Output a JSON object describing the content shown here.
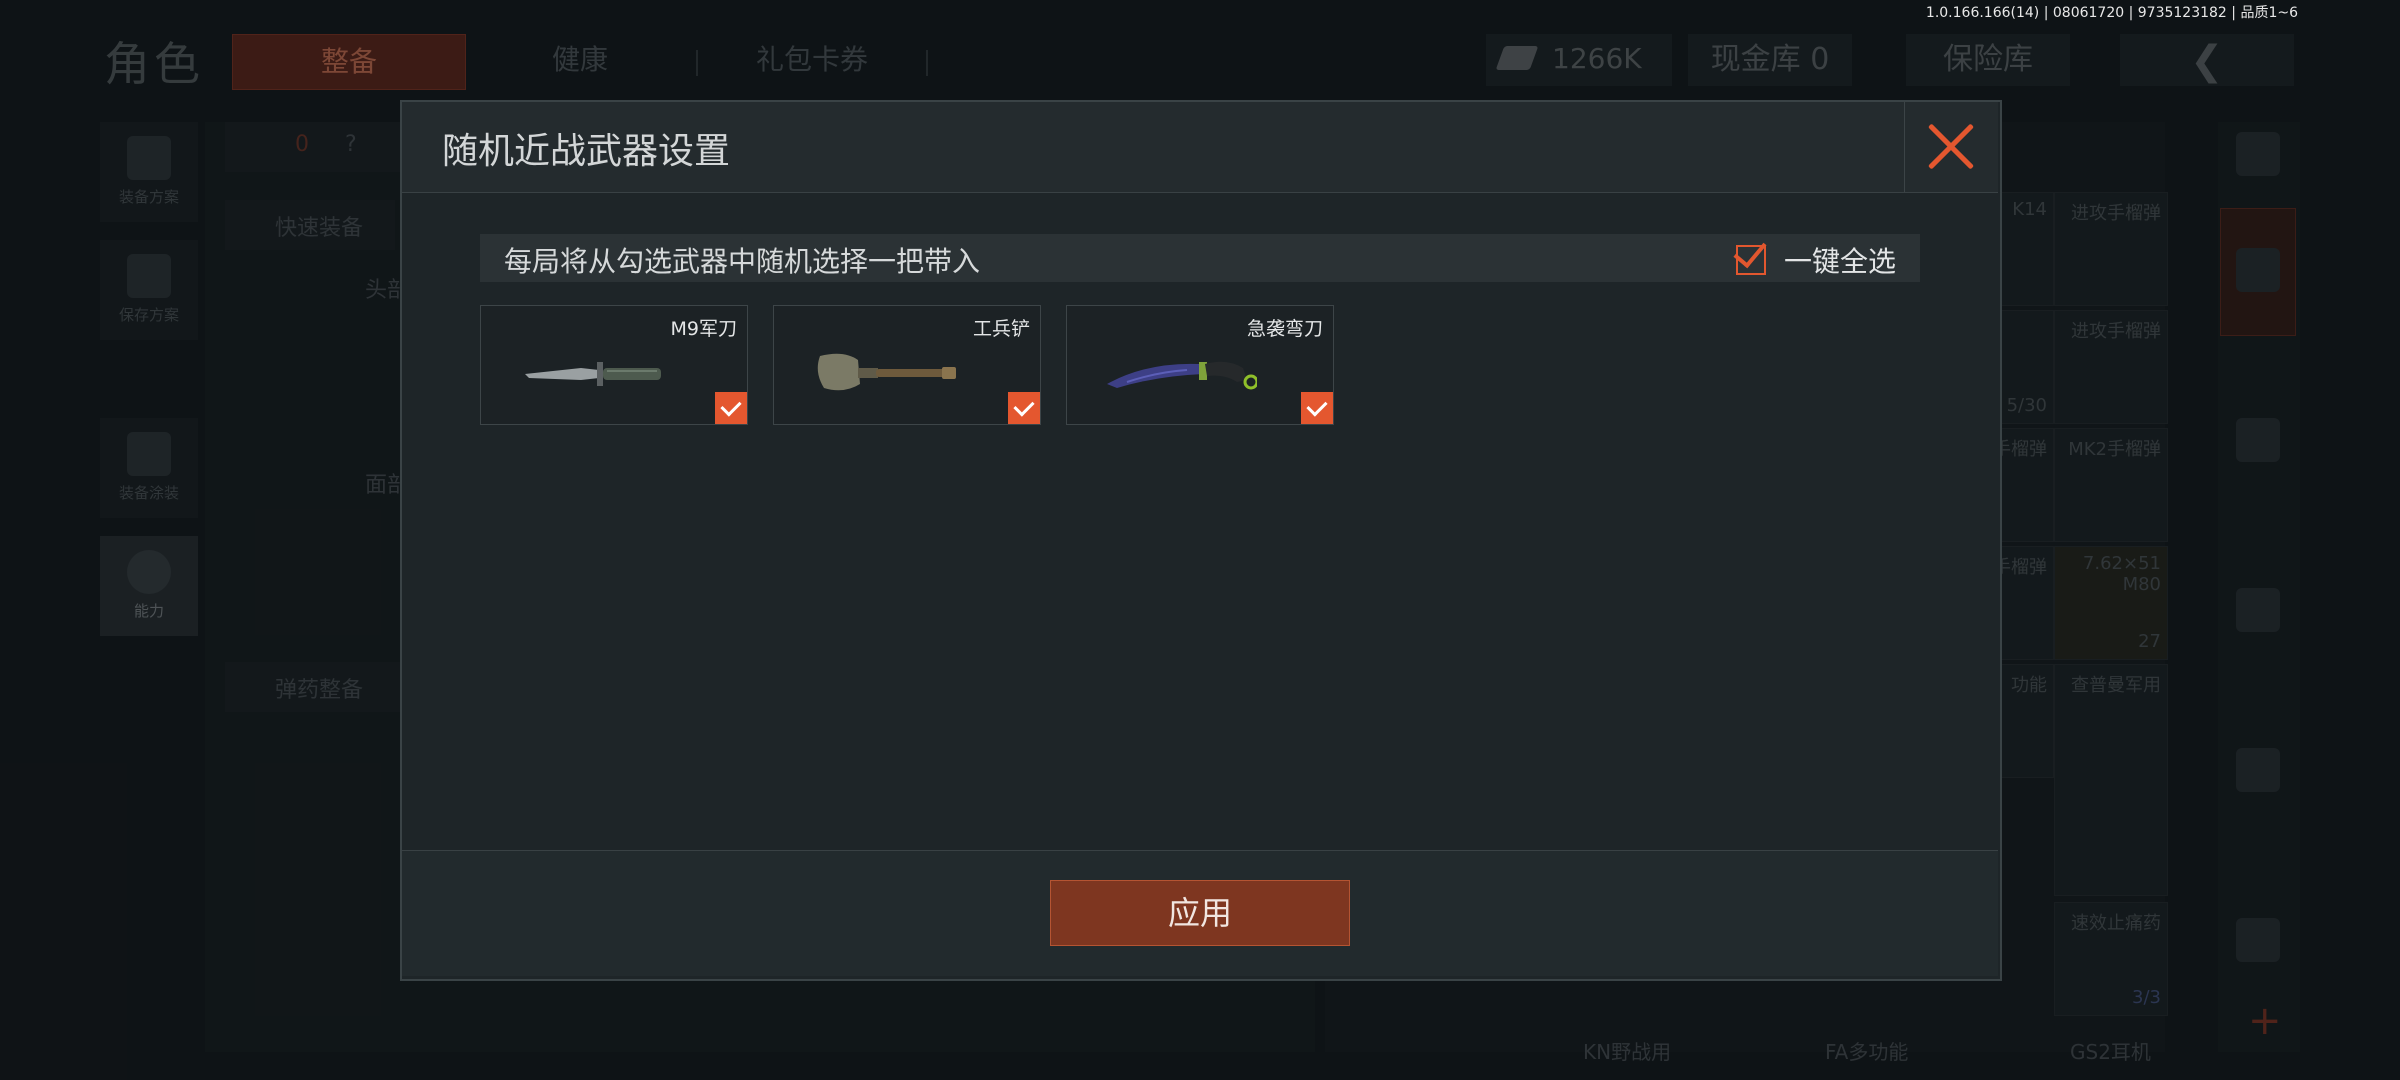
{
  "version": "1.0.166.166(14) | 08061720 | 9735123182 | 品质1~6",
  "topbar": {
    "title": "角色",
    "tabs": [
      "整备",
      "健康",
      "礼包卡券"
    ],
    "money": "1266K",
    "cash_vault": "现金库 0",
    "safe": "保险库"
  },
  "left_nav": {
    "items": [
      "装备方案",
      "保存方案",
      "装备涂装",
      "能力"
    ]
  },
  "bg_panel": {
    "counter": "0",
    "help": "?",
    "quick_equip": "快速装备",
    "head_label": "头部",
    "face_label": "面部",
    "ammo_equip": "弹药整备"
  },
  "bg_grid": {
    "items": [
      "K14",
      "进攻手榴弹",
      "进攻手榴弹",
      "5/30",
      "手榴弹",
      "MK2手榴弹",
      "手榴弹",
      "7.62×51 M80",
      "27",
      "功能",
      "查普曼军用",
      "速效止痛药",
      "3/3",
      "KN野战用",
      "FA多功能",
      "GS2耳机"
    ]
  },
  "modal": {
    "title": "随机近战武器设置",
    "info": "每局将从勾选武器中随机选择一把带入",
    "select_all": "一键全选",
    "weapons": [
      {
        "name": "M9军刀",
        "checked": true,
        "icon": "bayonet-knife-icon"
      },
      {
        "name": "工兵铲",
        "checked": true,
        "icon": "shovel-icon"
      },
      {
        "name": "急袭弯刀",
        "checked": true,
        "icon": "karambit-icon"
      }
    ],
    "apply": "应用"
  },
  "colors": {
    "accent": "#e4572f",
    "apply_bg": "#7e3620",
    "modal_bg": "#1e2528"
  }
}
